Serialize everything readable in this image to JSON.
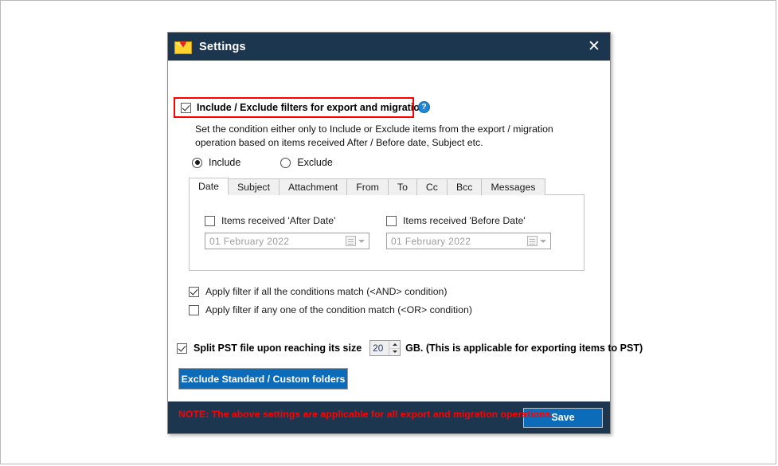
{
  "window": {
    "title": "Settings",
    "app_icon": "envelope-heart-icon",
    "close_label": "✕",
    "titlebar_color": "#1d364f"
  },
  "filters": {
    "master_checkbox_label": "Include / Exclude filters for export and migration",
    "master_checkbox_checked": true,
    "highlight_color": "#ff0000",
    "help_icon_label": "?",
    "description": "Set the condition either only to Include or Exclude items from the export / migration operation based on items received After / Before date, Subject etc.",
    "mode_options": [
      {
        "label": "Include",
        "selected": true
      },
      {
        "label": "Exclude",
        "selected": false
      }
    ]
  },
  "tabs": [
    {
      "label": "Date",
      "active": true
    },
    {
      "label": "Subject",
      "active": false
    },
    {
      "label": "Attachment",
      "active": false
    },
    {
      "label": "From",
      "active": false
    },
    {
      "label": "To",
      "active": false
    },
    {
      "label": "Cc",
      "active": false
    },
    {
      "label": "Bcc",
      "active": false
    },
    {
      "label": "Messages",
      "active": false
    }
  ],
  "date_panel": {
    "after": {
      "checkbox_label": "Items received 'After Date'",
      "checked": false,
      "value": "01  February   2022",
      "picker_icon": "calendar-icon"
    },
    "before": {
      "checkbox_label": "Items received 'Before Date'",
      "checked": false,
      "value": "01  February   2022",
      "picker_icon": "calendar-icon"
    }
  },
  "conditions": [
    {
      "label": "Apply filter if all the conditions match (<AND> condition)",
      "checked": true
    },
    {
      "label": "Apply filter if any one of the condition match (<OR> condition)",
      "checked": false
    }
  ],
  "split_pst": {
    "checkbox_label": "Split PST file upon reaching its size",
    "checked": true,
    "size_value": "20",
    "unit_note": "GB. (This is applicable for exporting items to PST)"
  },
  "exclude_button": {
    "label": "Exclude Standard / Custom folders",
    "color": "#0d6cb9"
  },
  "note": "NOTE: The above settings are applicable for all export and migration operations.",
  "footer": {
    "save_label": "Save",
    "save_color": "#0d6cb9"
  }
}
